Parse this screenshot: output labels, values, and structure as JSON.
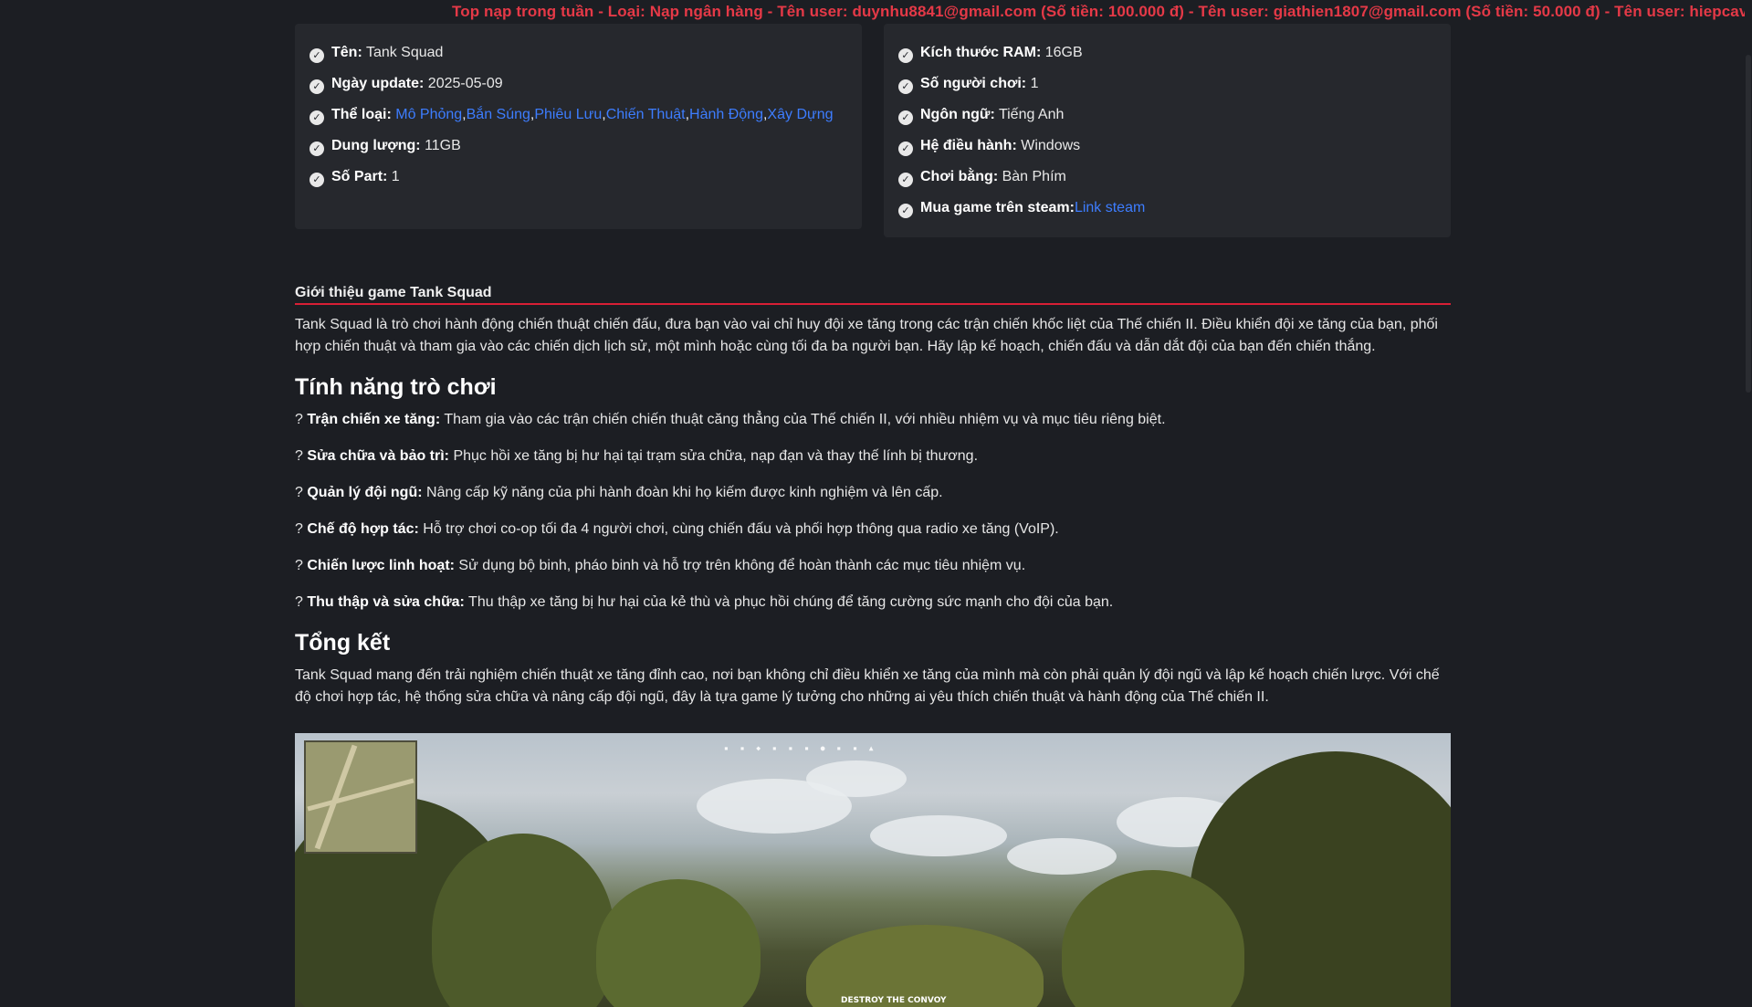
{
  "ticker": {
    "text": "Top nạp trong tuần - Loại: Nạp ngân hàng - Tên user: duynhu8841@gmail.com (Số tiền: 100.000 đ) - Tên user: giathien1807@gmail.com (Số tiền: 50.000 đ) - Tên user: hiepcav"
  },
  "info_left": {
    "name_label": "Tên:",
    "name_value": "Tank Squad",
    "update_label": "Ngày update:",
    "update_value": "2025-05-09",
    "genre_label": "Thể loại:",
    "genres": [
      "Mô Phỏng",
      "Bắn Súng",
      "Phiêu Lưu",
      "Chiến Thuật",
      "Hành Động",
      "Xây Dựng"
    ],
    "size_label": "Dung lượng:",
    "size_value": "11GB",
    "parts_label": "Số Part:",
    "parts_value": "1"
  },
  "info_right": {
    "ram_label": "Kích thước RAM:",
    "ram_value": "16GB",
    "players_label": "Số người chơi:",
    "players_value": "1",
    "lang_label": "Ngôn ngữ:",
    "lang_value": "Tiếng Anh",
    "os_label": "Hệ điều hành:",
    "os_value": "Windows",
    "control_label": "Chơi bằng:",
    "control_value": "Bàn Phím",
    "steam_label": "Mua game trên steam:",
    "steam_link": "Link steam"
  },
  "article": {
    "intro_heading": "Giới thiệu game Tank Squad",
    "intro_text": "Tank Squad là trò chơi hành động chiến thuật chiến đấu, đưa bạn vào vai chỉ huy đội xe tăng trong các trận chiến khốc liệt của Thế chiến II. Điều khiển đội xe tăng của bạn, phối hợp chiến thuật và tham gia vào các chiến dịch lịch sử, một mình hoặc cùng tối đa ba người bạn. Hãy lập kế hoạch, chiến đấu và dẫn dắt đội của bạn đến chiến thắng.",
    "features_heading": "Tính năng trò chơi",
    "features": [
      {
        "prefix": "? ",
        "title": "Trận chiến xe tăng:",
        "text": " Tham gia vào các trận chiến chiến thuật căng thẳng của Thế chiến II, với nhiều nhiệm vụ và mục tiêu riêng biệt."
      },
      {
        "prefix": "? ",
        "title": "Sửa chữa và bảo trì:",
        "text": " Phục hồi xe tăng bị hư hại tại trạm sửa chữa, nạp đạn và thay thế lính bị thương."
      },
      {
        "prefix": "? ",
        "title": "Quản lý đội ngũ:",
        "text": " Nâng cấp kỹ năng của phi hành đoàn khi họ kiếm được kinh nghiệm và lên cấp."
      },
      {
        "prefix": "? ",
        "title": "Chế độ hợp tác:",
        "text": " Hỗ trợ chơi co-op tối đa 4 người chơi, cùng chiến đấu và phối hợp thông qua radio xe tăng (VoIP)."
      },
      {
        "prefix": "? ",
        "title": "Chiến lược linh hoạt:",
        "text": " Sử dụng bộ binh, pháo binh và hỗ trợ trên không để hoàn thành các mục tiêu nhiệm vụ."
      },
      {
        "prefix": "? ",
        "title": "Thu thập và sửa chữa:",
        "text": " Thu thập xe tăng bị hư hại của kẻ thù và phục hồi chúng để tăng cường sức mạnh cho đội của bạn."
      }
    ],
    "summary_heading": "Tổng kết",
    "summary_text": "Tank Squad mang đến trải nghiệm chiến thuật xe tăng đỉnh cao, nơi bạn không chỉ điều khiển xe tăng của mình mà còn phải quản lý đội ngũ và lập kế hoạch chiến lược. Với chế độ chơi hợp tác, hệ thống sửa chữa và nâng cấp đội ngũ, đây là tựa game lý tưởng cho những ai yêu thích chiến thuật và hành động của Thế chiến II."
  },
  "screenshot": {
    "objective": "DESTROY THE CONVOY"
  }
}
